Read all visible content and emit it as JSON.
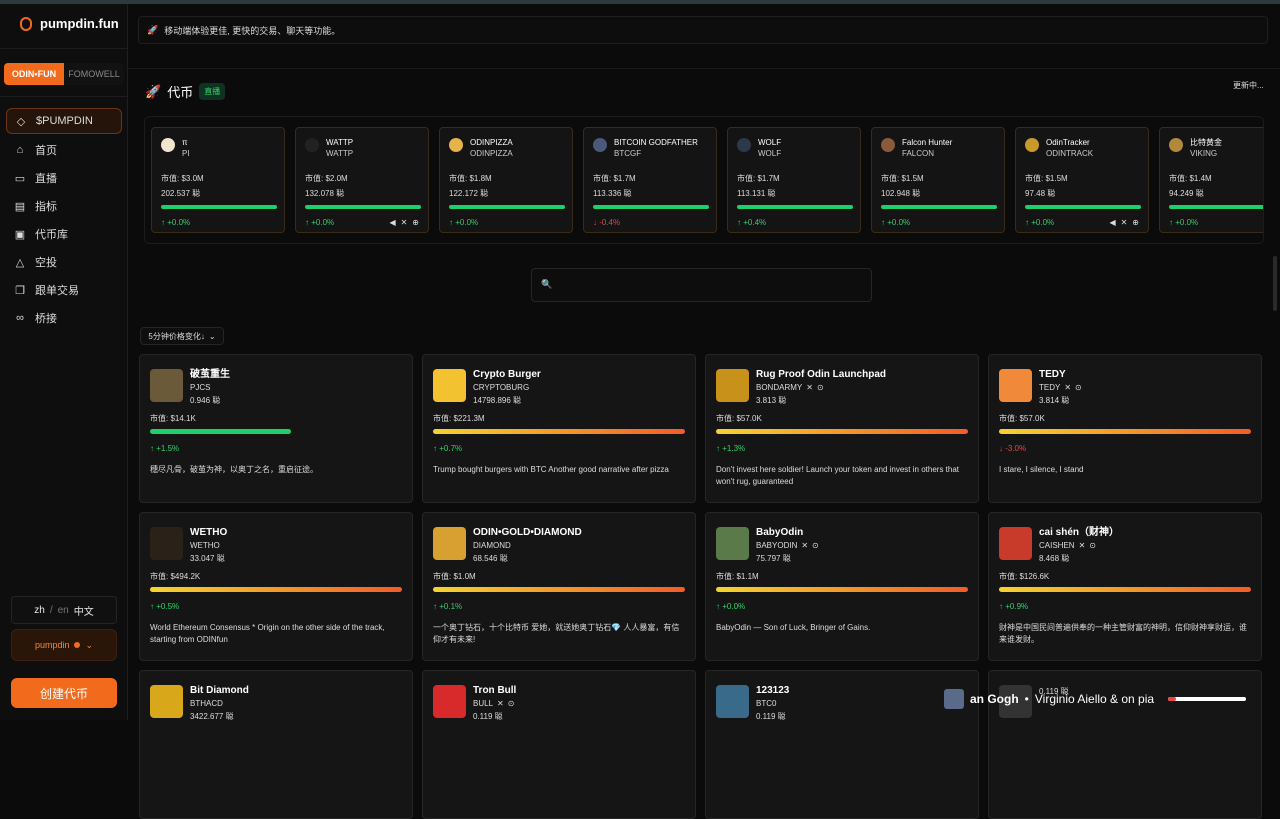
{
  "app": {
    "brand": "pumpdin.fun"
  },
  "sidebar": {
    "toggle": {
      "active": "ODIN•FUN",
      "inactive": "FOMOWELL"
    },
    "items": [
      {
        "label": "$PUMPDIN",
        "icon": "diamond-icon"
      },
      {
        "label": "首页",
        "icon": "home-icon"
      },
      {
        "label": "直播",
        "icon": "video-icon"
      },
      {
        "label": "指标",
        "icon": "chart-icon"
      },
      {
        "label": "代币库",
        "icon": "coin-library-icon"
      },
      {
        "label": "空投",
        "icon": "airdrop-icon"
      },
      {
        "label": "跟单交易",
        "icon": "copy-trade-icon"
      },
      {
        "label": "桥接",
        "icon": "link-icon"
      }
    ],
    "lang": {
      "zh": "zh",
      "slash": "/",
      "en": "en",
      "zh_full": "中文"
    },
    "wallet": "pumpdin",
    "create": "创建代币"
  },
  "banner": "移动端体验更佳, 更快的交易、聊天等功能。",
  "trending": {
    "title": "代币",
    "live": "直播",
    "status": "更新中...",
    "cards": [
      {
        "name": "π",
        "symbol": "PI",
        "cap": "市值: $3.0M",
        "holders": "202.537 聪",
        "change": "↑ +0.0%",
        "dir": "up",
        "socials": false,
        "color": "#f0e6d0"
      },
      {
        "name": "WATTP",
        "symbol": "WATTP",
        "cap": "市值: $2.0M",
        "holders": "132.078 聪",
        "change": "↑ +0.0%",
        "dir": "up",
        "socials": true,
        "color": "#222"
      },
      {
        "name": "ODINPIZZA",
        "symbol": "ODINPIZZA",
        "cap": "市值: $1.8M",
        "holders": "122.172 聪",
        "change": "↑ +0.0%",
        "dir": "up",
        "socials": false,
        "color": "#e6b24a"
      },
      {
        "name": "BITCOIN GODFATHER",
        "symbol": "BTCGF",
        "cap": "市值: $1.7M",
        "holders": "113.336 聪",
        "change": "↓ -0.4%",
        "dir": "down",
        "socials": false,
        "color": "#4a5a7a"
      },
      {
        "name": "WOLF",
        "symbol": "WOLF",
        "cap": "市值: $1.7M",
        "holders": "113.131 聪",
        "change": "↑ +0.4%",
        "dir": "up",
        "socials": false,
        "color": "#2a3a4a"
      },
      {
        "name": "Falcon Hunter",
        "symbol": "FALCON",
        "cap": "市值: $1.5M",
        "holders": "102.948 聪",
        "change": "↑ +0.0%",
        "dir": "up",
        "socials": false,
        "color": "#8a5a3a"
      },
      {
        "name": "OdinTracker",
        "symbol": "ODINTRACK",
        "cap": "市值: $1.5M",
        "holders": "97.48 聪",
        "change": "↑ +0.0%",
        "dir": "up",
        "socials": true,
        "color": "#c89a2a"
      },
      {
        "name": "比特黄金",
        "symbol": "VIKING",
        "cap": "市值: $1.4M",
        "holders": "94.249 聪",
        "change": "↑ +0.0%",
        "dir": "up",
        "socials": false,
        "color": "#b08a3a"
      }
    ]
  },
  "sort": {
    "label": "5分钟价格变化↓",
    "chevron": "⌄"
  },
  "grid": [
    {
      "name": "破茧重生",
      "symbol": "PJCS",
      "sats": "0.946 聪",
      "cap": "市值: $14.1K",
      "change": "↑ +1.5%",
      "dir": "up",
      "desc": "穗尽凡骨，破茧为神，以奥丁之名，重启征途。",
      "bar": "green",
      "progress": 0.56,
      "img": "#6a5a3a",
      "socials": false
    },
    {
      "name": "Crypto Burger",
      "symbol": "CRYPTOBURG",
      "sats": "14798.896 聪",
      "cap": "市值: $221.3M",
      "change": "↑ +0.7%",
      "dir": "up",
      "desc": "Trump bought burgers with BTC Another good narrative after pizza",
      "bar": "orange",
      "progress": 1,
      "img": "#f2c230",
      "socials": false
    },
    {
      "name": "Rug Proof Odin Launchpad",
      "symbol": "BONDARMY",
      "sats": "3.813 聪",
      "cap": "市值: $57.0K",
      "change": "↑ +1.3%",
      "dir": "up",
      "desc": "Don't invest here soldier! Launch your token and invest in others that won't rug, guaranteed",
      "bar": "orange",
      "progress": 1,
      "img": "#c8921a",
      "socials": true
    },
    {
      "name": "TEDY",
      "symbol": "TEDY",
      "sats": "3.814 聪",
      "cap": "市值: $57.0K",
      "change": "↓ -3.0%",
      "dir": "down",
      "desc": "I stare, I silence, I stand",
      "bar": "orange",
      "progress": 1,
      "img": "#f08a3a",
      "socials": true
    },
    {
      "name": "WETHO",
      "symbol": "WETHO",
      "sats": "33.047 聪",
      "cap": "市值: $494.2K",
      "change": "↑ +0.5%",
      "dir": "up",
      "desc": "World Ethereum Consensus * Origin on the other side of the track, starting from ODINfun",
      "bar": "orange",
      "progress": 1,
      "img": "#2a2218",
      "socials": false
    },
    {
      "name": "ODIN•GOLD•DIAMOND",
      "symbol": "DIAMOND",
      "sats": "68.546 聪",
      "cap": "市值: $1.0M",
      "change": "↑ +0.1%",
      "dir": "up",
      "desc": "一个奥丁钻石，十个比特币 爱她，就送她奥丁钻石💎 人人暴富，有信仰才有未来!",
      "bar": "orange",
      "progress": 1,
      "img": "#d8a030",
      "socials": false
    },
    {
      "name": "BabyOdin",
      "symbol": "BABYODIN",
      "sats": "75.797 聪",
      "cap": "市值: $1.1M",
      "change": "↑ +0.0%",
      "dir": "up",
      "desc": "BabyOdin — Son of Luck, Bringer of Gains.",
      "bar": "orange",
      "progress": 1,
      "img": "#5a7a4a",
      "socials": true
    },
    {
      "name": "cai shén（财神）",
      "symbol": "CAISHEN",
      "sats": "8.468 聪",
      "cap": "市值: $126.6K",
      "change": "↑ +0.9%",
      "dir": "up",
      "desc": "财神是中国民间普遍供奉的一种主管财富的神明，信仰财神享财运，谁来谁发财。",
      "bar": "orange",
      "progress": 1,
      "img": "#c83a2a",
      "socials": true
    },
    {
      "name": "Bit Diamond",
      "symbol": "BTHACD",
      "sats": "3422.677 聪",
      "cap": "",
      "change": "",
      "dir": "up",
      "desc": "",
      "bar": "orange",
      "progress": 1,
      "img": "#d8a81a",
      "socials": false
    },
    {
      "name": "Tron Bull",
      "symbol": "BULL",
      "sats": "0.119 聪",
      "cap": "",
      "change": "",
      "dir": "up",
      "desc": "",
      "bar": "orange",
      "progress": 1,
      "img": "#d82a2a",
      "socials": true
    },
    {
      "name": "123123",
      "symbol": "BTC0",
      "sats": "0.119 聪",
      "cap": "",
      "change": "",
      "dir": "up",
      "desc": "",
      "bar": "orange",
      "progress": 1,
      "img": "#3a6a8a",
      "socials": false
    },
    {
      "name": "",
      "symbol": "",
      "sats": "0.119 聪",
      "cap": "",
      "change": "",
      "dir": "up",
      "desc": "",
      "bar": "orange",
      "progress": 1,
      "img": "#333",
      "socials": false
    }
  ],
  "player": {
    "artist": "an Gogh",
    "dot": "•",
    "track": "Virginio Aiello & on pia"
  },
  "colors": {
    "accent": "#f26b1d",
    "up": "#2fd36b",
    "down": "#e64545"
  }
}
